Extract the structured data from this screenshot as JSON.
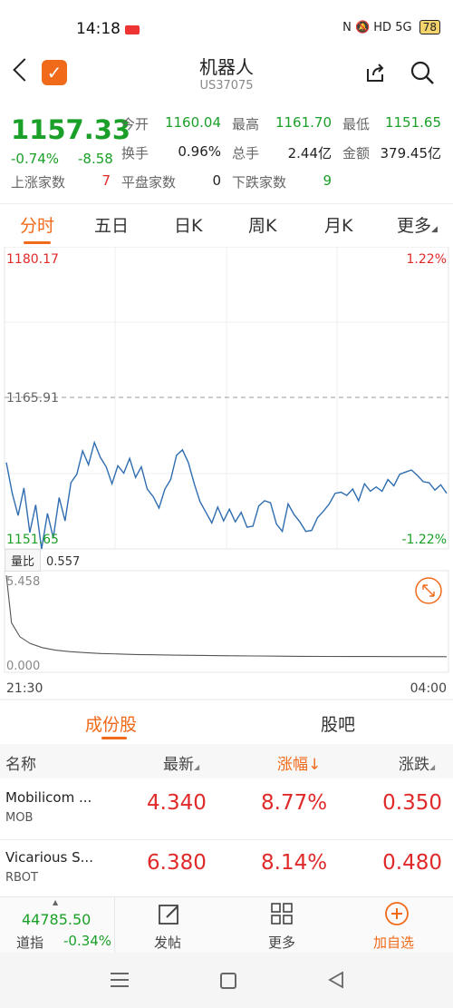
{
  "status": {
    "time": "14:18",
    "signal": "5G",
    "battery": "78"
  },
  "header": {
    "title": "机器人",
    "code": "US37075"
  },
  "quote": {
    "price": "1157.33",
    "change_pct": "-0.74%",
    "change": "-8.58",
    "open_label": "今开",
    "open": "1160.04",
    "high_label": "最高",
    "high": "1161.70",
    "low_label": "最低",
    "low": "1151.65",
    "turnover_label": "换手",
    "turnover": "0.96%",
    "volume_label": "总手",
    "volume": "2.44亿",
    "amount_label": "金额",
    "amount": "379.45亿",
    "up_label": "上涨家数",
    "up": "7",
    "flat_label": "平盘家数",
    "flat": "0",
    "down_label": "下跌家数",
    "down": "9"
  },
  "tabs": [
    "分时",
    "五日",
    "日K",
    "周K",
    "月K",
    "更多"
  ],
  "chart": {
    "max": "1180.17",
    "max_pct": "1.22%",
    "mid": "1165.91",
    "min": "1151.65",
    "min_pct": "-1.22%",
    "ratio_label": "量比",
    "ratio_value": "0.557",
    "ratio_max": "5.458",
    "ratio_min": "0.000",
    "t_start": "21:30",
    "t_end": "04:00"
  },
  "chart_data": [
    {
      "type": "line",
      "title": "",
      "xlabel": "",
      "ylabel": "",
      "x_range": [
        "21:30",
        "04:00"
      ],
      "ylim": [
        1151.65,
        1180.17
      ],
      "reference": 1165.91,
      "values": [
        1159.8,
        1156.9,
        1154.8,
        1157.4,
        1153.2,
        1155.8,
        1151.65,
        1155.0,
        1152.7,
        1156.5,
        1154.3,
        1157.9,
        1158.7,
        1160.9,
        1159.6,
        1161.7,
        1160.3,
        1159.4,
        1157.8,
        1159.5,
        1158.8,
        1160.2,
        1158.4,
        1159.4,
        1157.3,
        1156.6,
        1155.5,
        1157.3,
        1158.2,
        1160.5,
        1161.0,
        1159.8,
        1157.8,
        1156.1,
        1155.1,
        1154.1,
        1155.6,
        1154.3,
        1155.4,
        1154.2,
        1155.1,
        1153.7,
        1153.8,
        1155.7,
        1156.2,
        1156.0,
        1154.0,
        1153.3,
        1155.9,
        1154.9,
        1154.2,
        1153.3,
        1153.4,
        1154.6,
        1155.2,
        1155.9,
        1156.9,
        1157.0,
        1156.7,
        1157.3,
        1156.2,
        1157.8,
        1157.1,
        1157.5,
        1157.1,
        1158.2,
        1157.6,
        1158.7,
        1158.9,
        1159.1,
        1158.6,
        1158.0,
        1157.9,
        1157.2,
        1157.7,
        1156.9
      ],
      "grid": true
    },
    {
      "type": "line",
      "title": "",
      "series": [
        {
          "name": "量比",
          "values": [
            5.458,
            2.6,
            1.75,
            1.35,
            1.1,
            0.95,
            0.86,
            0.8,
            0.75,
            0.72,
            0.69,
            0.67,
            0.65,
            0.64,
            0.62,
            0.61,
            0.6,
            0.59,
            0.58,
            0.575,
            0.57,
            0.565,
            0.562,
            0.56,
            0.557
          ]
        }
      ],
      "ylim": [
        0,
        5.458
      ]
    }
  ],
  "constituents": {
    "tab_active": "成份股",
    "tab_other": "股吧",
    "headers": {
      "name": "名称",
      "latest": "最新",
      "pct": "涨幅↓",
      "chg": "涨跌"
    },
    "rows": [
      {
        "name": "Mobilicom ...",
        "code": "MOB",
        "latest": "4.340",
        "pct": "8.77%",
        "chg": "0.350"
      },
      {
        "name": "Vicarious S...",
        "code": "RBOT",
        "latest": "6.380",
        "pct": "8.14%",
        "chg": "0.480"
      }
    ]
  },
  "bottom": {
    "index_value": "44785.50",
    "index_name": "道指",
    "index_pct": "-0.34%",
    "post_label": "发帖",
    "more_label": "更多",
    "add_label": "加自选"
  },
  "colors": {
    "up": "#e02a2a",
    "down": "#1aa028",
    "accent": "#f06a1a",
    "line": "#2f6db0"
  }
}
